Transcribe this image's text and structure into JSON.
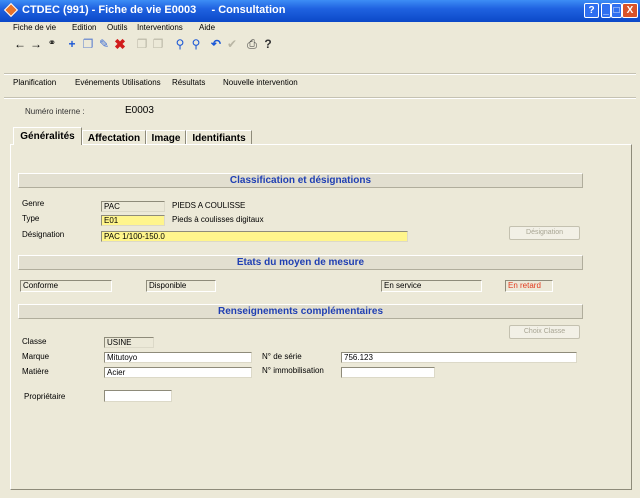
{
  "window": {
    "title": "CTDEC (991) - Fiche de vie E0003     - Consultation",
    "controls": {
      "help": "?",
      "minimize": "_",
      "maximize": "□",
      "close": "X"
    }
  },
  "menu": [
    "Fiche de vie",
    "Edition",
    "Outils",
    "Interventions",
    "Aide"
  ],
  "toolbar": {
    "icons": [
      "back-arrow-icon",
      "forward-arrow-icon",
      "binoculars-icon",
      "add-icon",
      "copy-icon",
      "edit-pen-icon",
      "delete-icon",
      "disabled-icon-1",
      "disabled-icon-2",
      "search-icon",
      "search-advanced-icon",
      "undo-icon",
      "check-icon",
      "print-icon",
      "help-icon"
    ]
  },
  "nav": [
    "Planification",
    "Evénements",
    "Utilisations",
    "Résultats",
    "Nouvelle intervention"
  ],
  "header": {
    "label": "Numéro interne :",
    "value": "E0003"
  },
  "tabs": [
    "Généralités",
    "Affectation",
    "Image",
    "Identifiants"
  ],
  "sections": {
    "classification": "Classification et désignations",
    "etats": "Etats du moyen de mesure",
    "renseignements": "Renseignements complémentaires"
  },
  "classification": {
    "genre_label": "Genre",
    "genre_code": "PAC",
    "genre_desc": "PIEDS A COULISSE",
    "type_label": "Type",
    "type_code": "E01",
    "type_desc": "Pieds à coulisses digitaux",
    "designation_label": "Désignation",
    "designation_value": "PAC 1/100-150.0",
    "designation_button": "Désignation"
  },
  "etats": {
    "conformite": "Conforme",
    "disponibilite": "Disponible",
    "service": "En service",
    "retard": "En retard"
  },
  "renseignements": {
    "classe_label": "Classe",
    "classe_value": "USINE",
    "choix_button": "Choix Classe",
    "marque_label": "Marque",
    "marque_value": "Mitutoyo",
    "matiere_label": "Matière",
    "matiere_value": "Acier",
    "serie_label": "N° de série",
    "serie_value": "756.123",
    "immo_label": "N° immobilisation",
    "immo_value": "",
    "proprietaire_label": "Propriétaire",
    "proprietaire_value": ""
  },
  "colors": {
    "section_text": "#1f3fb3",
    "yellow_field": "#fff58c",
    "retard_text": "#e23a1e",
    "title_bar": "#0b48c8"
  }
}
